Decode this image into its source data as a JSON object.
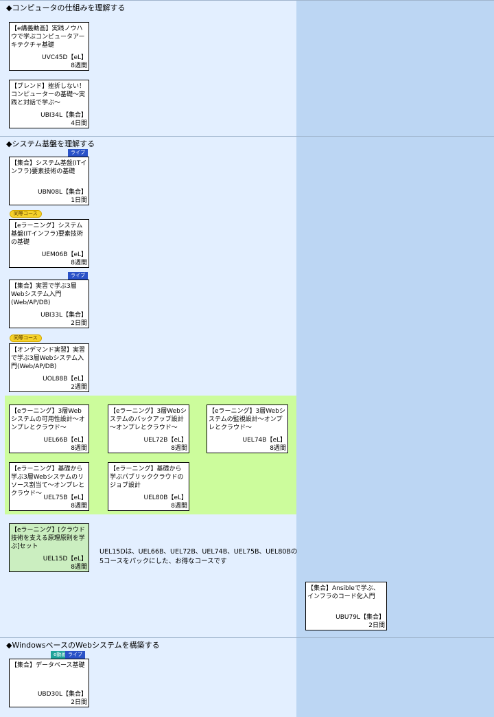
{
  "sections": {
    "computer": "◆コンピュータの仕組みを理解する",
    "system": "◆システム基盤を理解する",
    "windows": "◆WindowsベースのWebシステムを構築する"
  },
  "badges": {
    "live": "ライブ",
    "doutou": "同等コース",
    "edouga": "e動画"
  },
  "courses": {
    "uvc45d": {
      "title": "【e講義動画】実践ノウハウで学ぶコンピュータアーキテクチャ基礎",
      "code": "UVC45D【eL】",
      "duration": "8週間"
    },
    "ubi34l": {
      "title": "【ブレンド】挫折しない！コンピューターの基礎～実践と対話で学ぶ～",
      "code": "UBI34L【集合】",
      "duration": "4日間"
    },
    "ubn08l": {
      "title": "【集合】システム基盤(ITインフラ)要素技術の基礎",
      "code": "UBN08L【集合】",
      "duration": "1日間"
    },
    "uem06b": {
      "title": "【eラーニング】システム基盤(ITインフラ)要素技術の基礎",
      "code": "UEM06B【eL】",
      "duration": "8週間"
    },
    "ubi33l": {
      "title": "【集合】実習で学ぶ3層Webシステム入門(Web/AP/DB)",
      "code": "UBI33L【集合】",
      "duration": "2日間"
    },
    "uol88b": {
      "title": "【オンデマンド実習】実習で学ぶ3層Webシステム入門(Web/AP/DB)",
      "code": "UOL88B【eL】",
      "duration": "2週間"
    },
    "uel66b": {
      "title": "【eラーニング】3層Webシステムの可用性設計～オンプレとクラウド～",
      "code": "UEL66B【eL】",
      "duration": "8週間"
    },
    "uel72b": {
      "title": "【eラーニング】3層Webシステムのバックアップ設計～オンプレとクラウド～",
      "code": "UEL72B【eL】",
      "duration": "8週間"
    },
    "uel74b": {
      "title": "【eラーニング】3層Webシステムの監視設計～オンプレとクラウド～",
      "code": "UEL74B【eL】",
      "duration": "8週間"
    },
    "uel75b": {
      "title": "【eラーニング】基礎から学ぶ3層Webシステムのリソース割当て～オンプレとクラウド～",
      "code": "UEL75B【eL】",
      "duration": "8週間"
    },
    "uel80b": {
      "title": "【eラーニング】基礎から学ぶパブリッククラウドのジョブ設計",
      "code": "UEL80B【eL】",
      "duration": "8週間"
    },
    "uel15d": {
      "title": "【eラーニング】[クラウド技術を支える原理原則を学ぶ]セット",
      "code": "UEL15D【eL】",
      "duration": "8週間"
    },
    "ubu79l": {
      "title": "【集合】Ansibleで学ぶ、インフラのコード化入門",
      "code": "UBU79L【集合】",
      "duration": "2日間"
    },
    "ubd30l": {
      "title": "【集合】データベース基礎",
      "code": "UBD30L【集合】",
      "duration": "2日間"
    }
  },
  "note": {
    "line1": "UEL15Dは、UEL66B、UEL72B、UEL74B、UEL75B、UEL80Bの",
    "line2": "5コースをパックにした、お得なコースです"
  }
}
